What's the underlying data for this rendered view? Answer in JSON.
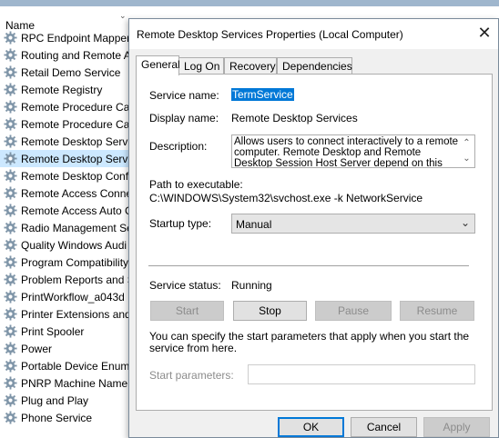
{
  "services_list": {
    "column_header": "Name",
    "items": [
      "RPC Endpoint Mapper",
      "Routing and Remote A",
      "Retail Demo Service",
      "Remote Registry",
      "Remote Procedure Cal",
      "Remote Procedure Cal",
      "Remote Desktop Servic",
      "Remote Desktop Servic",
      "Remote Desktop Confi",
      "Remote Access Conne",
      "Remote Access Auto C",
      "Radio Management Se",
      "Quality Windows Audi",
      "Program Compatibility",
      "Problem Reports and S",
      "PrintWorkflow_a043d",
      "Printer Extensions and",
      "Print Spooler",
      "Power",
      "Portable Device Enume",
      "PNRP Machine Name I",
      "Plug and Play",
      "Phone Service"
    ],
    "selected_index": 7
  },
  "dialog": {
    "title": "Remote Desktop Services Properties (Local Computer)",
    "tabs": [
      "General",
      "Log On",
      "Recovery",
      "Dependencies"
    ],
    "active_tab": "General",
    "service_name_label": "Service name:",
    "service_name_value": "TermService",
    "display_name_label": "Display name:",
    "display_name_value": "Remote Desktop Services",
    "description_label": "Description:",
    "description_value": "Allows users to connect interactively to a remote computer. Remote Desktop and Remote Desktop Session Host Server depend on this service.  To",
    "path_label": "Path to executable:",
    "path_value": "C:\\WINDOWS\\System32\\svchost.exe -k NetworkService",
    "startup_type_label": "Startup type:",
    "startup_type_value": "Manual",
    "service_status_label": "Service status:",
    "service_status_value": "Running",
    "buttons": {
      "start": "Start",
      "stop": "Stop",
      "pause": "Pause",
      "resume": "Resume"
    },
    "help_text": "You can specify the start parameters that apply when you start the service from here.",
    "start_params_label": "Start parameters:",
    "start_params_value": "",
    "footer": {
      "ok": "OK",
      "cancel": "Cancel",
      "apply": "Apply"
    }
  },
  "colors": {
    "selection_highlight": "#0078d7",
    "row_selected": "#cce8ff"
  }
}
